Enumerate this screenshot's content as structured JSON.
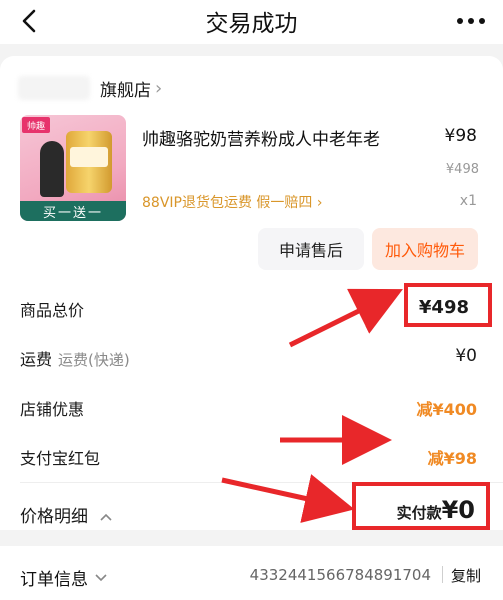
{
  "header": {
    "title": "交易成功"
  },
  "shop": {
    "name": "旗舰店"
  },
  "product": {
    "title": "帅趣骆驼奶营养粉成人中老年老",
    "price": "¥98",
    "original_price": "¥498",
    "promo_text": "88VIP退货包运费  假一赔四 ›",
    "quantity": "x1",
    "thumb_brand": "帅趣",
    "thumb_banner": "买一送一"
  },
  "actions": {
    "after_sale": "申请售后",
    "add_to_cart": "加入购物车"
  },
  "summary": {
    "total_label": "商品总价",
    "total_value": "¥498",
    "shipping_label": "运费",
    "shipping_sub": "运费(快递)",
    "shipping_value": "¥0",
    "shop_discount_label": "店铺优惠",
    "shop_discount_value": "减¥400",
    "alipay_label": "支付宝红包",
    "alipay_value": "减¥98",
    "detail_label": "价格明细",
    "paid_label": "实付款",
    "paid_value": "¥0"
  },
  "order": {
    "label": "订单信息",
    "number": "4332441566784891704",
    "copy_label": "复制"
  },
  "colors": {
    "accent_orange": "#f08a24",
    "cart_orange": "#ff5a0a",
    "annotation_red": "#e8272a"
  }
}
